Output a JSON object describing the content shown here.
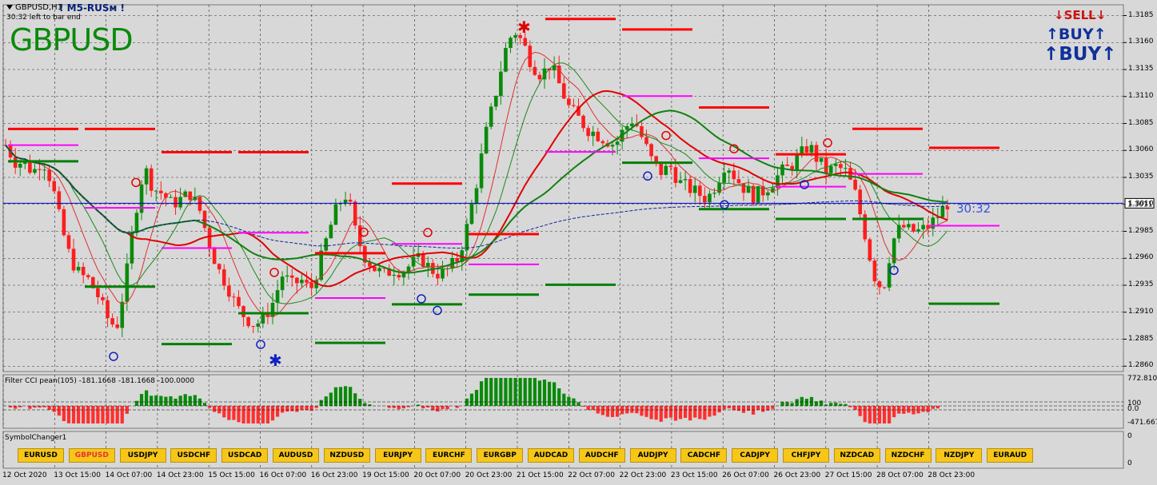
{
  "window": {
    "title": "GBPUSD,H1",
    "brand": "! M5-RUSм !",
    "timer_text": "30:32 left to bar end"
  },
  "symbol_label": "GBPUSD",
  "countdown": "30:32",
  "trade_buttons": {
    "sell": "SELL",
    "buy1": "BUY",
    "buy2": "BUY"
  },
  "chart_data": {
    "type": "candlestick",
    "symbol": "GBPUSD",
    "timeframe": "H1",
    "current_price": "1.3011",
    "price_ticks": [
      "1.3185",
      "1.3160",
      "1.3135",
      "1.3110",
      "1.3085",
      "1.3060",
      "1.3035",
      "1.3010",
      "1.2985",
      "1.2960",
      "1.2935",
      "1.2910",
      "1.2885",
      "1.2860"
    ],
    "ylim": [
      1.2855,
      1.3195
    ],
    "time_ticks": [
      "12 Oct 2020",
      "13 Oct 15:00",
      "14 Oct 07:00",
      "14 Oct 23:00",
      "15 Oct 15:00",
      "16 Oct 07:00",
      "16 Oct 23:00",
      "19 Oct 15:00",
      "20 Oct 07:00",
      "20 Oct 23:00",
      "21 Oct 15:00",
      "22 Oct 07:00",
      "22 Oct 23:00",
      "23 Oct 15:00",
      "26 Oct 07:00",
      "26 Oct 23:00",
      "27 Oct 15:00",
      "28 Oct 07:00",
      "28 Oct 23:00"
    ],
    "price_path": [
      1.3065,
      1.305,
      1.3048,
      1.304,
      1.3052,
      1.303,
      1.299,
      1.296,
      1.2945,
      1.294,
      1.2925,
      1.2905,
      1.2895,
      1.294,
      1.3,
      1.3045,
      1.3025,
      1.302,
      1.301,
      1.3015,
      1.302,
      1.3005,
      1.2975,
      1.295,
      1.2935,
      1.2915,
      1.2905,
      1.2898,
      1.2905,
      1.292,
      1.2945,
      1.2935,
      1.294,
      1.293,
      1.2955,
      1.2985,
      1.301,
      1.302,
      1.298,
      1.296,
      1.295,
      1.2945,
      1.295,
      1.2948,
      1.2955,
      1.296,
      1.295,
      1.2945,
      1.295,
      1.296,
      1.299,
      1.303,
      1.3075,
      1.311,
      1.315,
      1.3172,
      1.316,
      1.314,
      1.313,
      1.314,
      1.312,
      1.31,
      1.309,
      1.308,
      1.3075,
      1.307,
      1.3065,
      1.308,
      1.309,
      1.307,
      1.305,
      1.304,
      1.3045,
      1.303,
      1.3025,
      1.302,
      1.3015,
      1.303,
      1.305,
      1.3035,
      1.3025,
      1.3018,
      1.3022,
      1.303,
      1.304,
      1.3045,
      1.3055,
      1.3065,
      1.305,
      1.304,
      1.3045,
      1.304,
      1.302,
      1.2985,
      1.2945,
      1.293,
      1.2975,
      1.299,
      1.2985,
      1.2985,
      1.299,
      1.3,
      1.3011
    ],
    "indicator": {
      "name": "Filter CCI pean(105)",
      "values_text": "-181.1668 -181.1668 -100.0000",
      "ticks": [
        "772.8106",
        "100",
        "0.0",
        "-471.6677"
      ]
    },
    "panel3": {
      "name": "SymbolChanger1",
      "ticks": [
        "0",
        "0"
      ]
    }
  },
  "symbols": [
    "EURUSD",
    "GBPUSD",
    "USDJPY",
    "USDCHF",
    "USDCAD",
    "AUDUSD",
    "NZDUSD",
    "EURJPY",
    "EURCHF",
    "EURGBP",
    "AUDCAD",
    "AUDCHF",
    "AUDJPY",
    "CADCHF",
    "CADJPY",
    "CHFJPY",
    "NZDCAD",
    "NZDCHF",
    "NZDJPY",
    "EURAUD"
  ],
  "active_symbol": "GBPUSD",
  "colors": {
    "background": "#d8d8d8",
    "bull_candle": "#0a8a0a",
    "bear_candle": "#ff1e1e",
    "resistance": "#ff0000",
    "support": "#008000",
    "pivot": "#ff00ff",
    "price_line": "#0000cc",
    "sell": "#cc1111",
    "buy": "#10309a",
    "symbol_label": "#0a8a0a"
  }
}
